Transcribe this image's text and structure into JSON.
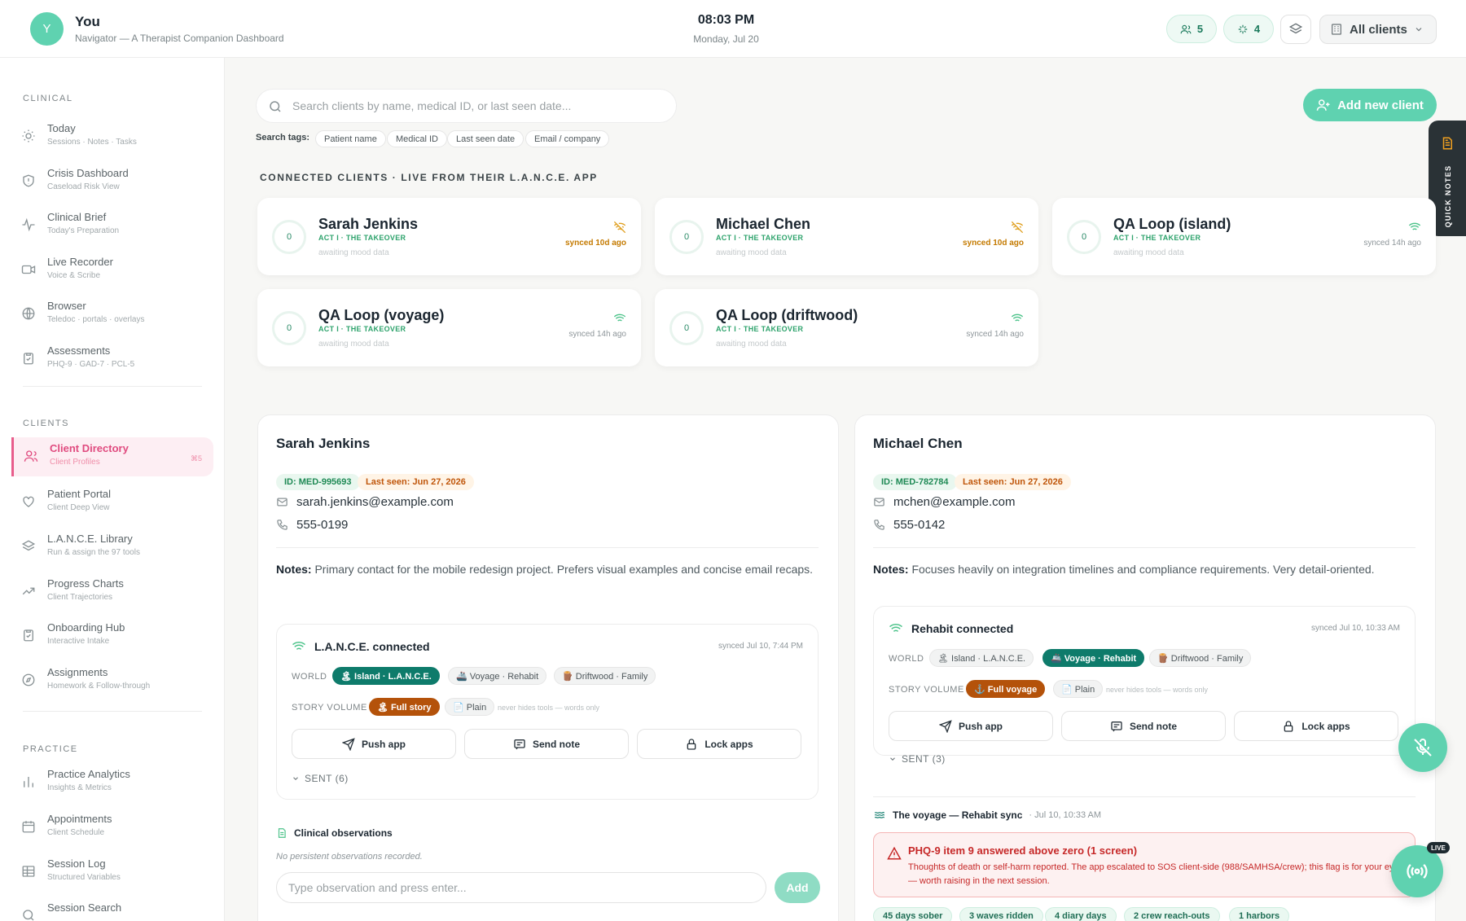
{
  "header": {
    "avatar_letter": "Y",
    "user_name": "You",
    "subtitle": "Navigator — A Therapist Companion Dashboard",
    "time": "08:03 PM",
    "date": "Monday, Jul 20",
    "clients_count": "5",
    "connected_count": "4",
    "client_filter": "All clients"
  },
  "sidebar": {
    "clinical_label": "CLINICAL",
    "clinical": [
      {
        "title": "Today",
        "sub": "Sessions · Notes · Tasks",
        "icon": "sun-icon"
      },
      {
        "title": "Crisis Dashboard",
        "sub": "Caseload Risk View",
        "icon": "shield-icon"
      },
      {
        "title": "Clinical Brief",
        "sub": "Today's Preparation",
        "icon": "pulse-icon"
      },
      {
        "title": "Live Recorder",
        "sub": "Voice & Scribe",
        "icon": "video-icon"
      },
      {
        "title": "Browser",
        "sub": "Teledoc · portals · overlays",
        "icon": "globe-icon"
      },
      {
        "title": "Assessments",
        "sub": "PHQ-9 · GAD-7 · PCL-5",
        "icon": "clipboard-icon"
      }
    ],
    "clients_label": "CLIENTS",
    "clients": [
      {
        "title": "Client Directory",
        "sub": "Client Profiles",
        "icon": "users-icon",
        "kbd": "⌘5"
      },
      {
        "title": "Patient Portal",
        "sub": "Client Deep View",
        "icon": "heart-icon"
      },
      {
        "title": "L.A.N.C.E. Library",
        "sub": "Run & assign the 97 tools",
        "icon": "layers-icon"
      },
      {
        "title": "Progress Charts",
        "sub": "Client Trajectories",
        "icon": "trend-icon"
      },
      {
        "title": "Onboarding Hub",
        "sub": "Interactive Intake",
        "icon": "clipboard-check-icon"
      },
      {
        "title": "Assignments",
        "sub": "Homework & Follow-through",
        "icon": "compass-icon"
      }
    ],
    "practice_label": "PRACTICE",
    "practice": [
      {
        "title": "Practice Analytics",
        "sub": "Insights & Metrics",
        "icon": "bar-chart-icon"
      },
      {
        "title": "Appointments",
        "sub": "Client Schedule",
        "icon": "calendar-icon"
      },
      {
        "title": "Session Log",
        "sub": "Structured Variables",
        "icon": "table-icon"
      },
      {
        "title": "Session Search",
        "sub": "",
        "icon": "search-icon"
      }
    ]
  },
  "search": {
    "placeholder": "Search clients by name, medical ID, or last seen date...",
    "tags_label": "Search tags:",
    "tags": [
      "Patient name",
      "Medical ID",
      "Last seen date",
      "Email / company"
    ]
  },
  "add_client": "Add new client",
  "quick_notes": "QUICK NOTES",
  "connected_title": "CONNECTED CLIENTS · LIVE FROM THEIR L.A.N.C.E. APP",
  "connected": [
    {
      "score": "0",
      "name": "Sarah Jenkins",
      "act": "ACT I · THE TAKEOVER",
      "mood": "awaiting mood data",
      "sync": "synced 10d ago",
      "online": false
    },
    {
      "score": "0",
      "name": "Michael Chen",
      "act": "ACT I · THE TAKEOVER",
      "mood": "awaiting mood data",
      "sync": "synced 10d ago",
      "online": false
    },
    {
      "score": "0",
      "name": "QA Loop (island)",
      "act": "ACT I · THE TAKEOVER",
      "mood": "awaiting mood data",
      "sync": "synced 14h ago",
      "online": true
    },
    {
      "score": "0",
      "name": "QA Loop (voyage)",
      "act": "ACT I · THE TAKEOVER",
      "mood": "awaiting mood data",
      "sync": "synced 14h ago",
      "online": true
    },
    {
      "score": "0",
      "name": "QA Loop (driftwood)",
      "act": "ACT I · THE TAKEOVER",
      "mood": "awaiting mood data",
      "sync": "synced 14h ago",
      "online": true
    }
  ],
  "profiles": [
    {
      "name": "Sarah Jenkins",
      "id": "ID: MED-995693",
      "last_seen": "Last seen: Jun 27, 2026",
      "email": "sarah.jenkins@example.com",
      "phone": "555-0199",
      "notes_label": "Notes:",
      "notes": "Primary contact for the mobile redesign project. Prefers visual examples and concise email recaps.",
      "lance_title": "L.A.N.C.E. connected",
      "lance_synced": "synced Jul 10, 7:44 PM",
      "world_label": "WORLD",
      "worlds": [
        "🏝 Island · L.A.N.C.E.",
        "🚢 Voyage · Rehabit",
        "🪵 Driftwood · Family"
      ],
      "volume_label": "STORY VOLUME",
      "volume_full": "🏝 Full story",
      "volume_plain": "📄 Plain",
      "volume_hint": "never hides tools — words only",
      "actions": [
        "Push app",
        "Send note",
        "Lock apps"
      ],
      "sent": "SENT (6)",
      "obs_title": "Clinical observations",
      "obs_none": "No persistent observations recorded.",
      "obs_placeholder": "Type observation and press enter...",
      "obs_add": "Add"
    },
    {
      "name": "Michael Chen",
      "id": "ID: MED-782784",
      "last_seen": "Last seen: Jun 27, 2026",
      "email": "mchen@example.com",
      "phone": "555-0142",
      "notes_label": "Notes:",
      "notes": "Focuses heavily on integration timelines and compliance requirements. Very detail-oriented.",
      "lance_title": "Rehabit connected",
      "lance_synced": "synced Jul 10, 10:33 AM",
      "world_label": "WORLD",
      "worlds": [
        "🏝 Island · L.A.N.C.E.",
        "🚢 Voyage · Rehabit",
        "🪵 Driftwood · Family"
      ],
      "volume_label": "STORY VOLUME",
      "volume_full": "⚓ Full voyage",
      "volume_plain": "📄 Plain",
      "volume_hint": "never hides tools — words only",
      "actions": [
        "Push app",
        "Send note",
        "Lock apps"
      ],
      "sent": "SENT (3)",
      "voyage_title": "The voyage — Rehabit sync",
      "voyage_time": "· Jul 10, 10:33 AM",
      "alert_title": "PHQ-9 item 9 answered above zero (1 screen)",
      "alert_text": "Thoughts of death or self-harm reported. The app escalated to SOS client-side (988/SAMHSA/crew); this flag is for your eyes — worth raising in the next session.",
      "stats": [
        "45 days sober",
        "3 waves ridden",
        "4 diary days",
        "2 crew reach-outs",
        "1 harbors"
      ]
    }
  ],
  "live_tag": "LIVE"
}
